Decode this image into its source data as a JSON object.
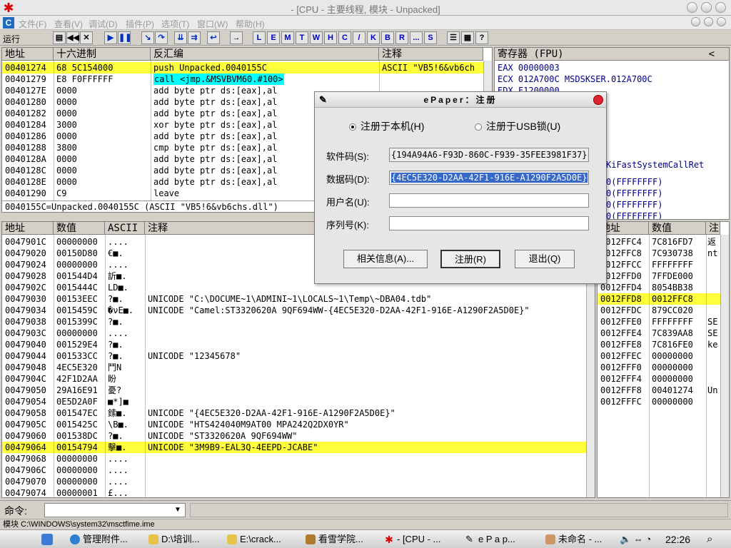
{
  "window": {
    "title": "- [CPU - 主要线程, 模块 - Unpacked]"
  },
  "menu": [
    "文件(F)",
    "查看(V)",
    "调试(D)",
    "插件(P)",
    "选项(T)",
    "窗口(W)",
    "帮助(H)"
  ],
  "toolbar": {
    "status": "运行",
    "letters": [
      "L",
      "E",
      "M",
      "T",
      "W",
      "H",
      "C",
      "/",
      "K",
      "B",
      "R",
      "...",
      "S"
    ]
  },
  "disasm": {
    "headers": [
      "地址",
      "十六进制",
      "反汇编",
      "注释"
    ],
    "rows": [
      {
        "addr": "00401274",
        "hex": "68 5C154000",
        "asm": "push Unpacked.0040155C",
        "comment": "ASCII \"VB5!6&vb6ch"
      },
      {
        "addr": "00401279",
        "hex": "E8 F0FFFFFF",
        "asm": "call <jmp.&MSVBVM60.#100>",
        "comment": ""
      },
      {
        "addr": "0040127E",
        "hex": "0000",
        "asm": "add byte ptr ds:[eax],al",
        "comment": ""
      },
      {
        "addr": "00401280",
        "hex": "0000",
        "asm": "add byte ptr ds:[eax],al",
        "comment": ""
      },
      {
        "addr": "00401282",
        "hex": "0000",
        "asm": "add byte ptr ds:[eax],al",
        "comment": ""
      },
      {
        "addr": "00401284",
        "hex": "3000",
        "asm": "xor byte ptr ds:[eax],al",
        "comment": ""
      },
      {
        "addr": "00401286",
        "hex": "0000",
        "asm": "add byte ptr ds:[eax],al",
        "comment": ""
      },
      {
        "addr": "00401288",
        "hex": "3800",
        "asm": "cmp byte ptr ds:[eax],al",
        "comment": ""
      },
      {
        "addr": "0040128A",
        "hex": "0000",
        "asm": "add byte ptr ds:[eax],al",
        "comment": ""
      },
      {
        "addr": "0040128C",
        "hex": "0000",
        "asm": "add byte ptr ds:[eax],al",
        "comment": ""
      },
      {
        "addr": "0040128E",
        "hex": "0000",
        "asm": "add byte ptr ds:[eax],al",
        "comment": ""
      },
      {
        "addr": "00401290",
        "hex": "C9",
        "asm": "leave",
        "comment": ""
      }
    ],
    "info": "0040155C=Unpacked.0040155C (ASCII \"VB5!6&vb6chs.dll\")"
  },
  "registers": {
    "header": "寄存器 (FPU)",
    "collapse": "<",
    "lines": [
      "EAX 00000003",
      "ECX 012A700C MSDSKSER.012A700C",
      "EDX F1200000"
    ],
    "partial": [
      "KiFastSystemCallRet",
      "0(FFFFFFFF)",
      "0(FFFFFFFF)",
      "0(FFFFFFFF)",
      "0(FFFFFFFF)"
    ]
  },
  "dump": {
    "headers": [
      "地址",
      "数值",
      "ASCII",
      "注释"
    ],
    "rows": [
      {
        "addr": "0047901C",
        "val": "00000000",
        "ascii": "....",
        "comment": ""
      },
      {
        "addr": "00479020",
        "val": "00150D80",
        "ascii": "€■.",
        "comment": ""
      },
      {
        "addr": "00479024",
        "val": "00000000",
        "ascii": "....",
        "comment": ""
      },
      {
        "addr": "00479028",
        "val": "001544D4",
        "ascii": "訢■.",
        "comment": ""
      },
      {
        "addr": "0047902C",
        "val": "0015444C",
        "ascii": "LD■.",
        "comment": ""
      },
      {
        "addr": "00479030",
        "val": "00153EEC",
        "ascii": "?■.",
        "comment": "UNICODE \"C:\\DOCUME~1\\ADMINI~1\\LOCALS~1\\Temp\\~DBA04.tdb\""
      },
      {
        "addr": "00479034",
        "val": "0015459C",
        "ascii": "�νE■.",
        "comment": "UNICODE \"Camel:ST3320620A  9QF694WW-{4EC5E320-D2AA-42F1-916E-A1290F2A5D0E}\""
      },
      {
        "addr": "00479038",
        "val": "0015399C",
        "ascii": "?■.",
        "comment": ""
      },
      {
        "addr": "0047903C",
        "val": "00000000",
        "ascii": "....",
        "comment": ""
      },
      {
        "addr": "00479040",
        "val": "001529E4",
        "ascii": "?■.",
        "comment": ""
      },
      {
        "addr": "00479044",
        "val": "001533CC",
        "ascii": "?■.",
        "comment": "UNICODE \"12345678\""
      },
      {
        "addr": "00479048",
        "val": "4EC5E320",
        "ascii": " 鬥N",
        "comment": ""
      },
      {
        "addr": "0047904C",
        "val": "42F1D2AA",
        "ascii": "  盼",
        "comment": ""
      },
      {
        "addr": "00479050",
        "val": "29A16E91",
        "ascii": "憂?",
        "comment": ""
      },
      {
        "addr": "00479054",
        "val": "0E5D2A0F",
        "ascii": "■*]■",
        "comment": ""
      },
      {
        "addr": "00479058",
        "val": "001547EC",
        "ascii": "鎍■.",
        "comment": "UNICODE \"{4EC5E320-D2AA-42F1-916E-A1290F2A5D0E}\""
      },
      {
        "addr": "0047905C",
        "val": "0015425C",
        "ascii": "\\B■.",
        "comment": "UNICODE \"HTS424040M9AT00  MPA242Q2DX0YR\""
      },
      {
        "addr": "00479060",
        "val": "001538DC",
        "ascii": "?■.",
        "comment": "UNICODE \"ST3320620A  9QF694WW\""
      },
      {
        "addr": "00479064",
        "val": "00154794",
        "ascii": "擊■.",
        "comment": "UNICODE \"3M9B9-EAL3Q-4EEPD-JCABE\""
      },
      {
        "addr": "00479068",
        "val": "00000000",
        "ascii": "....",
        "comment": ""
      },
      {
        "addr": "0047906C",
        "val": "00000000",
        "ascii": "....",
        "comment": ""
      },
      {
        "addr": "00479070",
        "val": "00000000",
        "ascii": "....",
        "comment": ""
      },
      {
        "addr": "00479074",
        "val": "00000001",
        "ascii": "£...",
        "comment": ""
      }
    ]
  },
  "stack": {
    "headers": [
      "地址",
      "数值",
      "注"
    ],
    "rows": [
      {
        "addr": "0012FFC4",
        "val": "7C816FD7",
        "c": "返"
      },
      {
        "addr": "0012FFC8",
        "val": "7C930738",
        "c": "nt"
      },
      {
        "addr": "0012FFCC",
        "val": "FFFFFFFF",
        "c": ""
      },
      {
        "addr": "0012FFD0",
        "val": "7FFDE000",
        "c": ""
      },
      {
        "addr": "0012FFD4",
        "val": "8054BB38",
        "c": ""
      },
      {
        "addr": "0012FFD8",
        "val": "0012FFC8",
        "c": ""
      },
      {
        "addr": "0012FFDC",
        "val": "879CC020",
        "c": ""
      },
      {
        "addr": "0012FFE0",
        "val": "FFFFFFFF",
        "c": "SE"
      },
      {
        "addr": "0012FFE4",
        "val": "7C839AA8",
        "c": "SE"
      },
      {
        "addr": "0012FFE8",
        "val": "7C816FE0",
        "c": "ke"
      },
      {
        "addr": "0012FFEC",
        "val": "00000000",
        "c": ""
      },
      {
        "addr": "0012FFF0",
        "val": "00000000",
        "c": ""
      },
      {
        "addr": "0012FFF4",
        "val": "00000000",
        "c": ""
      },
      {
        "addr": "0012FFF8",
        "val": "00401274",
        "c": "Un"
      },
      {
        "addr": "0012FFFC",
        "val": "00000000",
        "c": ""
      }
    ]
  },
  "dialog": {
    "title": "ePaper：注册",
    "radio_local": "注册于本机(H)",
    "radio_usb": "注册于USB锁(U)",
    "software_code_label": "软件码(S):",
    "software_code": "{194A94A6-F93D-860C-F939-35FEE3981F37}",
    "data_code_label": "数据码(D):",
    "data_code": "{4EC5E320-D2AA-42F1-916E-A1290F2A5D0E}",
    "username_label": "用户名(U):",
    "username": "",
    "serial_label": "序列号(K):",
    "serial": "",
    "btn_info": "相关信息(A)...",
    "btn_register": "注册(R)",
    "btn_exit": "退出(Q)"
  },
  "command": {
    "label": "命令:",
    "value": ""
  },
  "status": "模块 C:\\WINDOWS\\system32\\msctfime.ime",
  "taskbar": {
    "tasks": [
      "管理附件...",
      "D:\\培训...",
      "E:\\crack...",
      "看雪学院...",
      "- [CPU - ...",
      "e P a p...",
      "未命名 - ..."
    ],
    "clock": "22:26"
  }
}
